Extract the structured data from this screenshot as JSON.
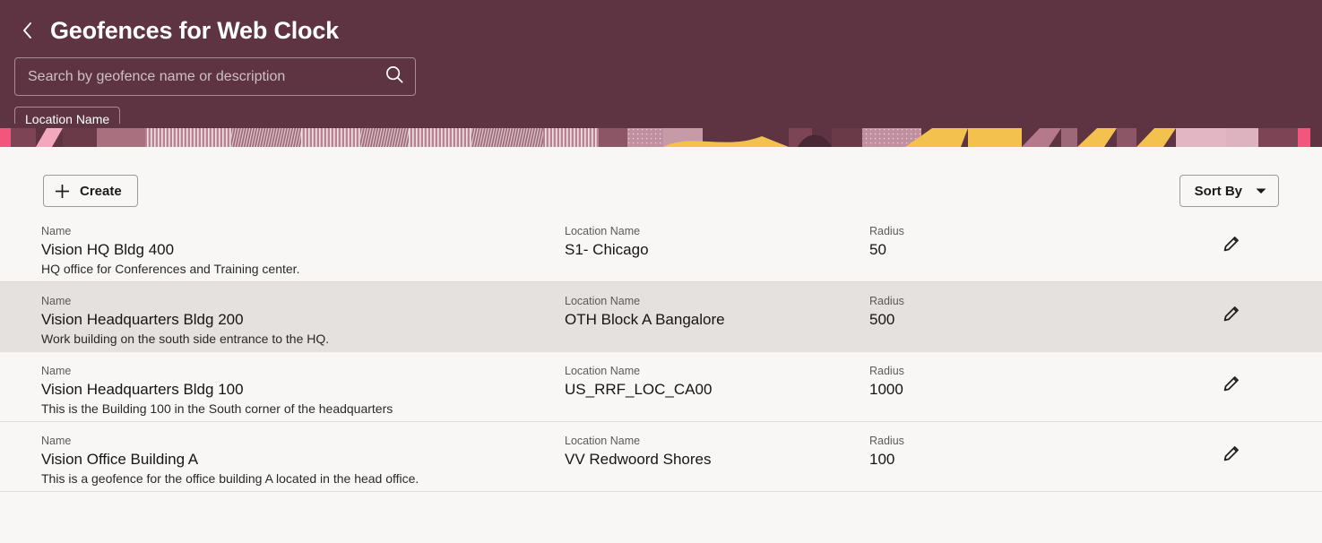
{
  "header": {
    "back_icon": "chevron-left-icon",
    "title": "Geofences for Web Clock",
    "search": {
      "value": "",
      "placeholder": "Search by geofence name or description",
      "icon": "search-icon"
    },
    "chips": [
      {
        "label": "Location Name"
      }
    ],
    "colors": {
      "background": "#5e3342",
      "border": "#a88b95",
      "text": "#ffffff",
      "placeholder": "#cfc0c5",
      "pattern_pink": "#f2a8bd",
      "pattern_yellow": "#f2c14e",
      "pattern_mauve": "#a9707f",
      "pattern_light": "#ddb3c0"
    }
  },
  "toolbar": {
    "create_label": "Create",
    "create_icon": "plus-icon",
    "sort_label": "Sort By",
    "sort_icon": "chevron-down-icon"
  },
  "list": {
    "labels": {
      "name": "Name",
      "location_name": "Location Name",
      "radius": "Radius"
    },
    "edit_icon": "pencil-icon",
    "rows": [
      {
        "name": "Vision HQ Bldg 400",
        "description": "HQ office for Conferences and Training center.",
        "location_name": "S1- Chicago",
        "radius": "50",
        "selected": false
      },
      {
        "name": "Vision Headquarters Bldg 200",
        "description": "Work building on the south side entrance to the HQ.",
        "location_name": "OTH Block A Bangalore",
        "radius": "500",
        "selected": true
      },
      {
        "name": "Vision Headquarters Bldg 100",
        "description": "This is the Building 100 in the South corner of the headquarters",
        "location_name": "US_RRF_LOC_CA00",
        "radius": "1000",
        "selected": false
      },
      {
        "name": "Vision Office Building A",
        "description": "This is a geofence for the office building A located in the head office.",
        "location_name": "VV Redwoord Shores",
        "radius": "100",
        "selected": false
      }
    ]
  },
  "theme": {
    "page_background": "#f8f7f5",
    "row_selected_background": "#e4e1df",
    "separator": "#dddad7",
    "text_primary": "#161513",
    "text_secondary": "#5b5b5b"
  }
}
